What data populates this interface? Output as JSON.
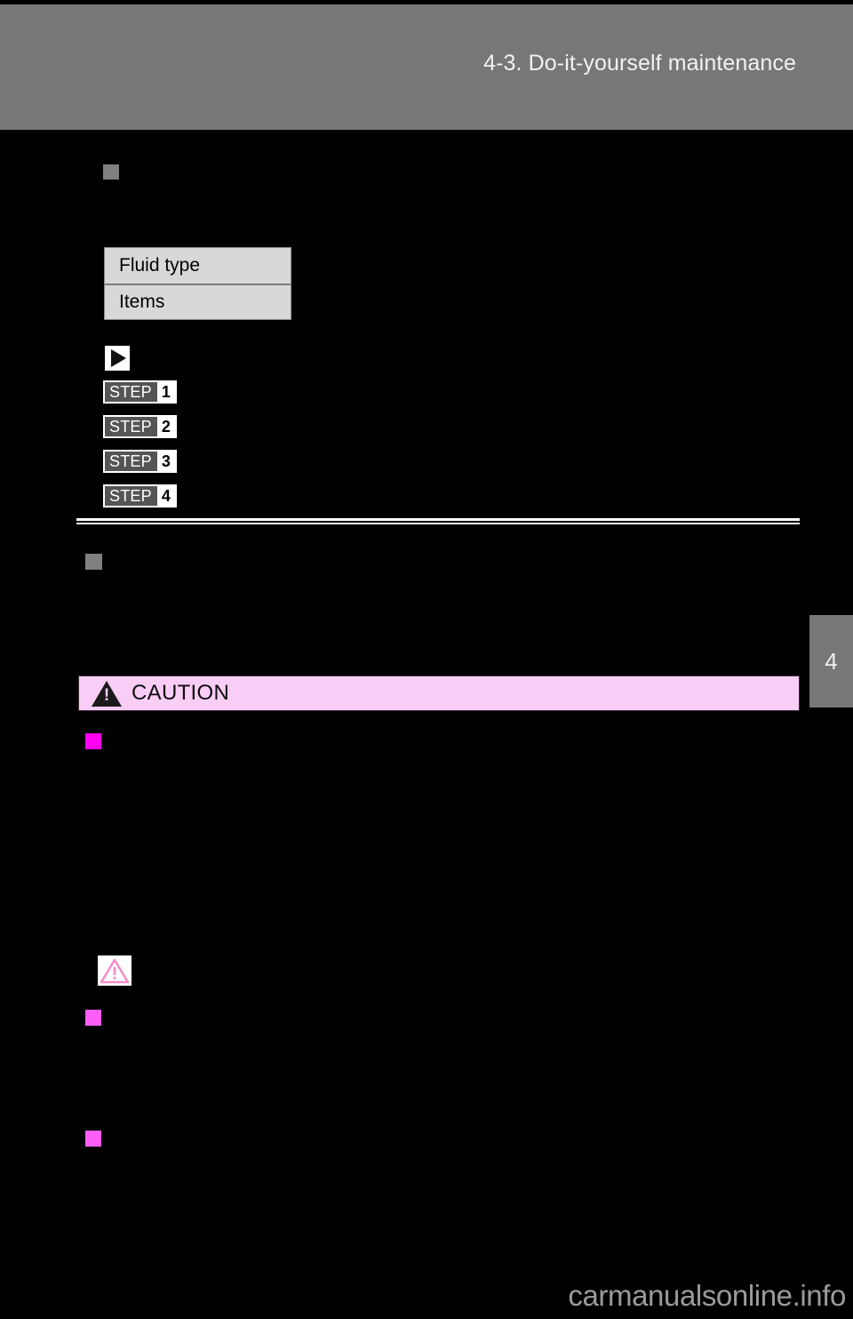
{
  "page": {
    "background_color": "#000000",
    "header": {
      "band_color": "#777777",
      "title": "4-3. Do-it-yourself maintenance"
    },
    "chapter_tab": {
      "number": "4",
      "color": "#777777"
    },
    "watermark": "carmanualsonline.info"
  },
  "sections": {
    "first": {
      "bullet_icon": "gray-square-bullet",
      "bullet_color": "#808080"
    },
    "second": {
      "bullet_icon": "gray-square-bullet",
      "bullet_color": "#808080"
    }
  },
  "spec_table": {
    "border_color": "#8a8a8a",
    "cell_background": "#d8d8d8",
    "rows": [
      {
        "label": "Fluid type"
      },
      {
        "label": "Items"
      }
    ]
  },
  "procedure": {
    "marker_icon": "play-triangle-icon",
    "steps": [
      {
        "word": "STEP",
        "number": "1"
      },
      {
        "word": "STEP",
        "number": "2"
      },
      {
        "word": "STEP",
        "number": "3"
      },
      {
        "word": "STEP",
        "number": "4"
      }
    ]
  },
  "caution_box": {
    "label": "CAUTION",
    "background_color": "#facdf7",
    "icon": "warning-triangle-icon",
    "bullets": [
      {
        "color": "#ff00f0"
      },
      {
        "color": "#ff5ef6"
      },
      {
        "color": "#ff5ef6"
      }
    ],
    "notice_icon": "pink-warning-triangle-icon"
  }
}
